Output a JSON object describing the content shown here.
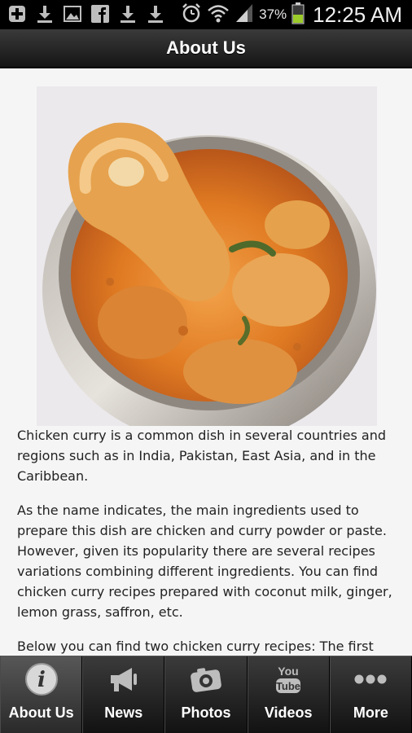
{
  "status_bar": {
    "battery_percent": "37%",
    "time": "12:25 AM",
    "icons": [
      "add-icon",
      "download-icon",
      "image-icon",
      "facebook-icon",
      "download-icon",
      "download-icon",
      "alarm-icon",
      "wifi-icon",
      "signal-icon",
      "battery-icon"
    ]
  },
  "header": {
    "title": "About Us"
  },
  "article": {
    "paragraphs": [
      "Chicken curry is a common dish in several countries and regions such as in India, Pakistan, East Asia, and in the Caribbean.",
      "As the name indicates, the main ingredients used to prepare this dish are chicken and curry powder or paste. However, given its popularity there are several recipes variations combining different ingredients. You can find chicken curry recipes prepared with coconut milk, ginger, lemon grass, saffron, etc.",
      "Below you can find two chicken curry recipes: The first one"
    ]
  },
  "tabs": [
    {
      "label": "About Us",
      "icon": "info-icon",
      "active": true
    },
    {
      "label": "News",
      "icon": "megaphone-icon",
      "active": false
    },
    {
      "label": "Photos",
      "icon": "camera-icon",
      "active": false
    },
    {
      "label": "Videos",
      "icon": "youtube-icon",
      "active": false
    },
    {
      "label": "More",
      "icon": "more-icon",
      "active": false
    }
  ],
  "colors": {
    "bar_dark": "#151515",
    "text": "#222222",
    "battery": "#9ccc2a"
  }
}
